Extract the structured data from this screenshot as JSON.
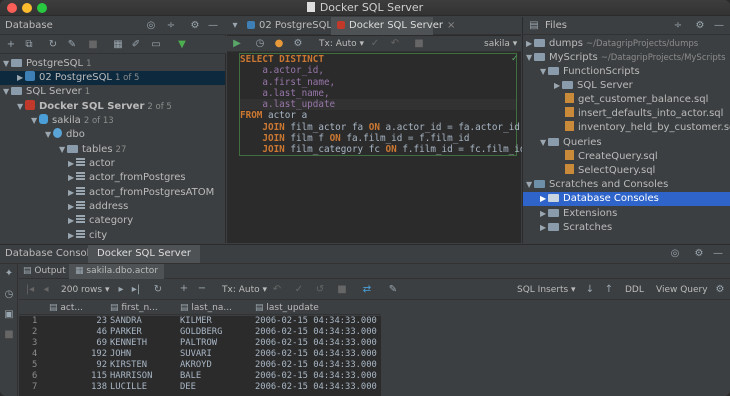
{
  "window": {
    "title": "Docker SQL Server"
  },
  "database_panel": {
    "title": "Database",
    "tree": [
      {
        "label": "PostgreSQL",
        "meta": "1"
      },
      {
        "label": "02 PostgreSQL",
        "meta": "1 of 5"
      },
      {
        "label": "SQL Server",
        "meta": "1"
      },
      {
        "label": "Docker SQL Server",
        "meta": "2 of 5"
      },
      {
        "label": "sakila",
        "meta": "2 of 13"
      },
      {
        "label": "dbo",
        "meta": ""
      },
      {
        "label": "tables",
        "meta": "27"
      },
      {
        "label": "actor",
        "meta": ""
      },
      {
        "label": "actor_fromPostgres",
        "meta": ""
      },
      {
        "label": "actor_fromPostgresATOM",
        "meta": ""
      },
      {
        "label": "address",
        "meta": ""
      },
      {
        "label": "category",
        "meta": ""
      },
      {
        "label": "city",
        "meta": ""
      }
    ]
  },
  "editor": {
    "tabs": [
      {
        "label": "02 PostgreSQL",
        "active": false
      },
      {
        "label": "Docker SQL Server",
        "active": true
      }
    ],
    "tx_mode": "Tx: Auto",
    "schema": "sakila",
    "lines": [
      "SELECT DISTINCT",
      "    a.actor_id,",
      "    a.first_name,",
      "    a.last_name,",
      "    a.last_update",
      "FROM actor a",
      "    JOIN film_actor fa ON a.actor_id = fa.actor_id",
      "    JOIN film f ON fa.film_id = f.film_id",
      "    JOIN film_category fc ON f.film_id = fc.film_id;"
    ]
  },
  "files_panel": {
    "title": "Files",
    "tree": [
      {
        "label": "dumps",
        "meta": "~/DatagripProjects/dumps"
      },
      {
        "label": "MyScripts",
        "meta": "~/DatagripProjects/MyScripts"
      },
      {
        "label": "FunctionScripts",
        "meta": ""
      },
      {
        "label": "SQL Server",
        "meta": ""
      },
      {
        "label": "get_customer_balance.sql",
        "meta": ""
      },
      {
        "label": "insert_defaults_into_actor.sql",
        "meta": ""
      },
      {
        "label": "inventory_held_by_customer.sql",
        "meta": ""
      },
      {
        "label": "Queries",
        "meta": ""
      },
      {
        "label": "CreateQuery.sql",
        "meta": ""
      },
      {
        "label": "SelectQuery.sql",
        "meta": ""
      },
      {
        "label": "Scratches and Consoles",
        "meta": ""
      },
      {
        "label": "Database Consoles",
        "meta": ""
      },
      {
        "label": "Extensions",
        "meta": ""
      },
      {
        "label": "Scratches",
        "meta": ""
      }
    ]
  },
  "console": {
    "title": "Database Console:",
    "source": "Docker SQL Server",
    "tabs": [
      {
        "label": "Output"
      },
      {
        "label": "sakila.dbo.actor"
      }
    ],
    "rows_label": "200 rows",
    "tx_mode": "Tx: Auto",
    "sql_inserts": "SQL Inserts",
    "ddl": "DDL",
    "view_query": "View Query",
    "columns": [
      "act...",
      "first_n...",
      "last_na...",
      "last_update"
    ],
    "rows": [
      [
        "1",
        "23",
        "SANDRA",
        "KILMER",
        "2006-02-15 04:34:33.000"
      ],
      [
        "2",
        "46",
        "PARKER",
        "GOLDBERG",
        "2006-02-15 04:34:33.000"
      ],
      [
        "3",
        "69",
        "KENNETH",
        "PALTROW",
        "2006-02-15 04:34:33.000"
      ],
      [
        "4",
        "192",
        "JOHN",
        "SUVARI",
        "2006-02-15 04:34:33.000"
      ],
      [
        "5",
        "92",
        "KIRSTEN",
        "AKROYD",
        "2006-02-15 04:34:33.000"
      ],
      [
        "6",
        "115",
        "HARRISON",
        "BALE",
        "2006-02-15 04:34:33.000"
      ],
      [
        "7",
        "138",
        "LUCILLE",
        "DEE",
        "2006-02-15 04:34:33.000"
      ]
    ]
  },
  "colors": {
    "background": "#2b2b2b",
    "panel": "#3c3f41",
    "selection": "#2f65ca",
    "keyword": "#cc7832",
    "field": "#9876aa"
  }
}
